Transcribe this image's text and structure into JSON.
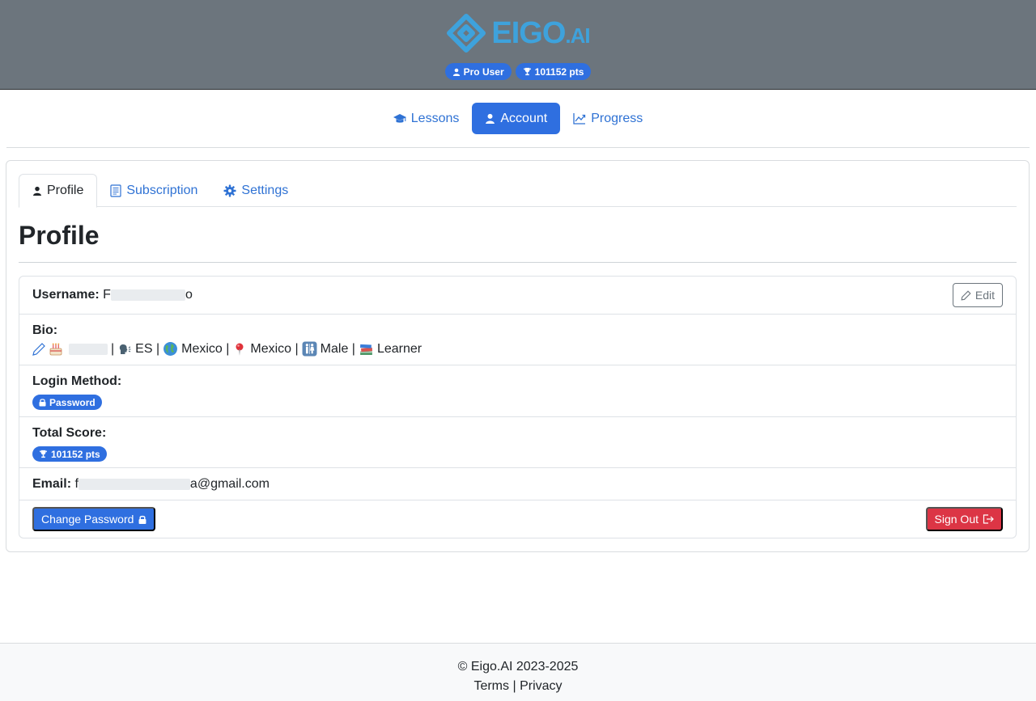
{
  "brand": {
    "logo_text": "EIGO",
    "logo_suffix": ".AI",
    "accent": "#3ea2dc"
  },
  "header": {
    "user_badge": "Pro User",
    "points_badge": "101152 pts"
  },
  "nav": {
    "lessons": "Lessons",
    "account": "Account",
    "progress": "Progress"
  },
  "tabs": {
    "profile": "Profile",
    "subscription": "Subscription",
    "settings": "Settings"
  },
  "profile": {
    "title": "Profile",
    "username_label": "Username:",
    "username_start": "F",
    "username_end": "o",
    "edit_label": "Edit",
    "bio_label": "Bio:",
    "bio_language": "ES |",
    "bio_country": "Mexico |",
    "bio_location": "Mexico |",
    "bio_gender": "Male |",
    "bio_role": "Learner",
    "login_label": "Login Method:",
    "login_method": "Password",
    "score_label": "Total Score:",
    "score_value": "101152 pts",
    "email_label": "Email:",
    "email_start": "f",
    "email_end": "a@gmail.com",
    "change_password": "Change Password",
    "sign_out": "Sign Out"
  },
  "footer": {
    "copyright": "© Eigo.AI 2023-2025",
    "terms": "Terms",
    "separator": "|",
    "privacy": "Privacy"
  },
  "colors": {
    "primary": "#2f6fe0",
    "danger": "#dc3545",
    "header_bg": "#6c757d"
  }
}
